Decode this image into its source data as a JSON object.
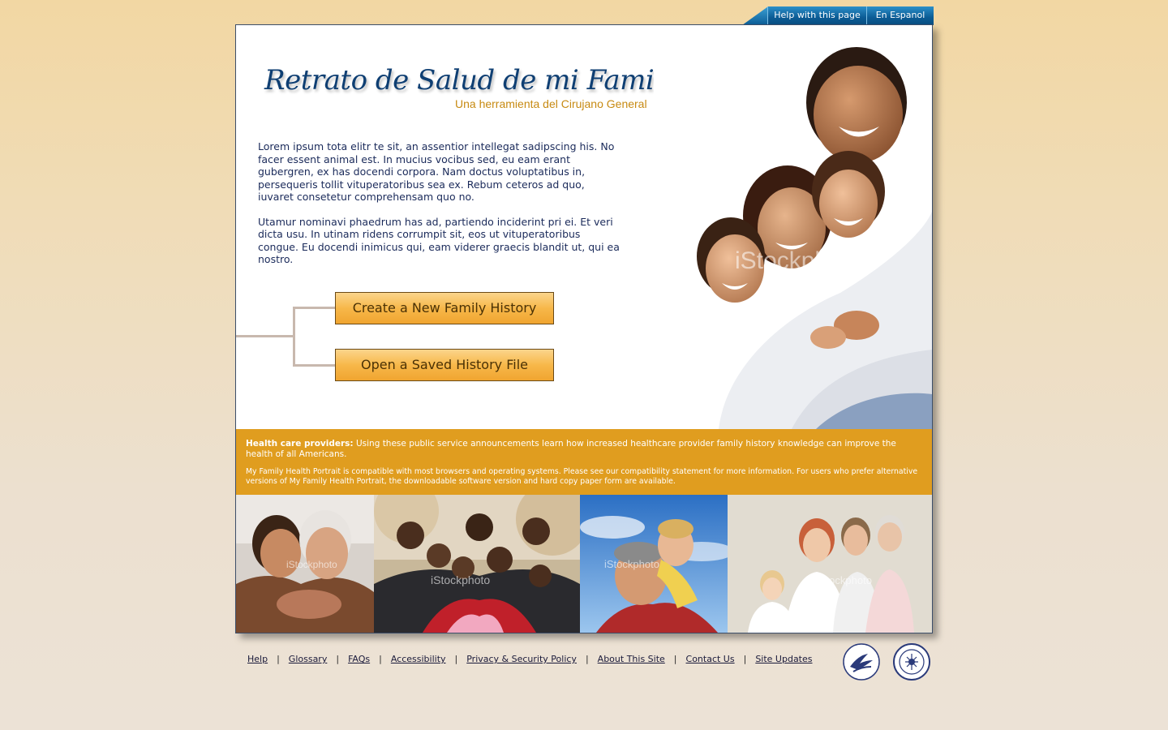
{
  "top_tabs": {
    "help": "Help with this page",
    "spanish": "En Espanol"
  },
  "hero": {
    "title": "Retrato de Salud de mi Familia",
    "subtitle": "Una herramienta del Cirujano General",
    "paragraph1": "Lorem ipsum tota elitr te sit, an assentior intellegat sadipscing his. No facer essent animal est. In mucius vocibus sed, eu eam erant gubergren, ex has docendi corpora. Nam doctus voluptatibus in, persequeris tollit vituperatoribus sea ex. Rebum ceteros ad quo, iuvaret consetetur comprehensam quo no.",
    "paragraph2": "Utamur nominavi phaedrum has ad, partiendo inciderint pri ei. Et veri dicta usu. In utinam ridens corrumpit sit, eos ut vituperatoribus congue. Eu docendi inimicus qui, eam viderer graecis blandit ut, qui ea nostro.",
    "watermark": "iStockphoto"
  },
  "buttons": {
    "create": "Create a New Family History",
    "open": "Open a Saved History File"
  },
  "band": {
    "providers_label": "Health care providers:",
    "providers_text": " Using these public service announcements learn how increased healthcare provider family history knowledge can improve the health of all Americans.",
    "compat_text": "My Family Health Portrait is compatible with most browsers and operating systems. Please see our compatibility statement for more information. For users who prefer alternative versions of My Family Health Portrait, the downloadable software version and hard copy paper form are available."
  },
  "footer": {
    "links": [
      "Help",
      "Glossary",
      "FAQs",
      "Accessibility",
      "Privacy & Security Policy",
      "About This Site",
      "Contact Us",
      "Site Updates"
    ],
    "separator": "|"
  },
  "colors": {
    "accent_orange": "#e09d1f",
    "title_blue": "#0f3f73",
    "tab_blue": "#0b5b94"
  }
}
